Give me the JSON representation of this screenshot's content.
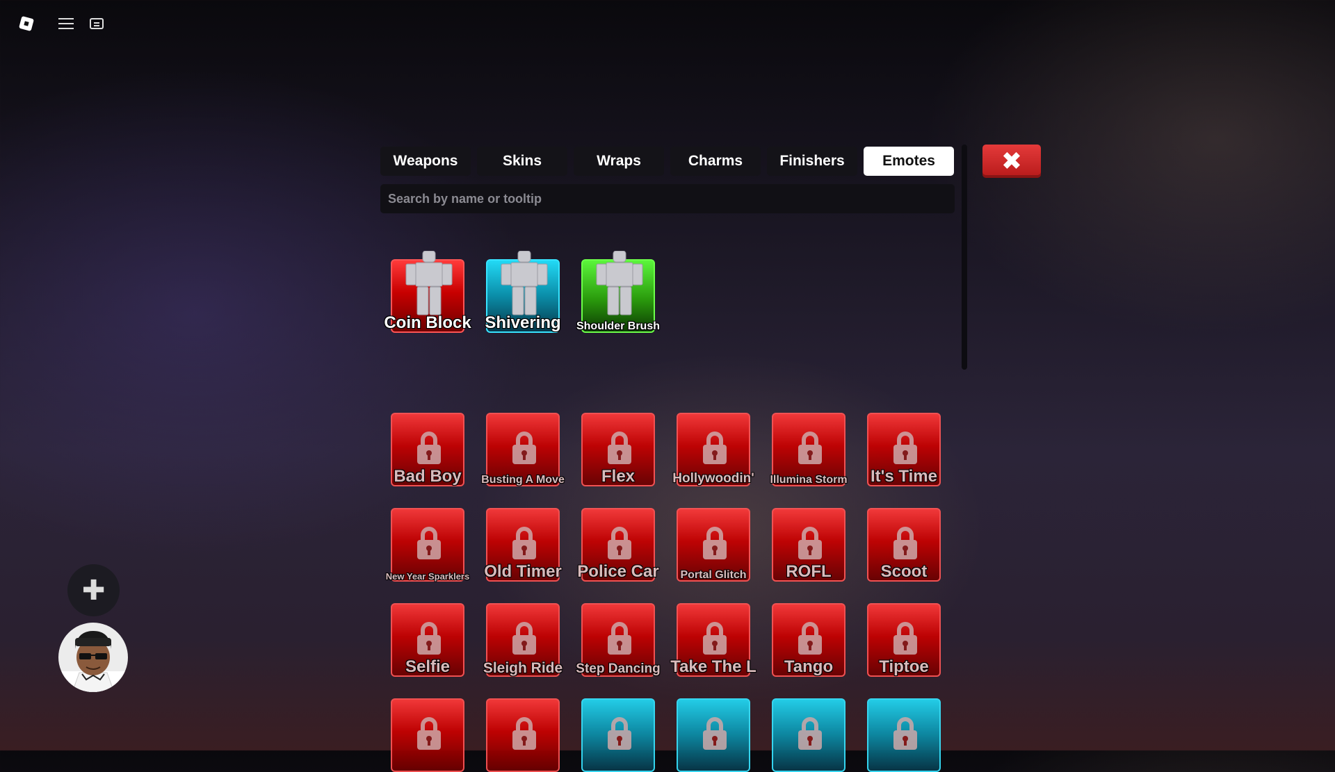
{
  "topbar": {
    "logo_icon": "roblox-logo-icon",
    "menu_icon": "hamburger-menu-icon",
    "chat_icon": "chat-icon"
  },
  "tabs": [
    {
      "label": "Weapons",
      "active": false
    },
    {
      "label": "Skins",
      "active": false
    },
    {
      "label": "Wraps",
      "active": false
    },
    {
      "label": "Charms",
      "active": false
    },
    {
      "label": "Finishers",
      "active": false
    },
    {
      "label": "Emotes",
      "active": true
    }
  ],
  "close_button": {
    "icon": "close-x-icon",
    "color": "#d62828"
  },
  "search": {
    "placeholder": "Search by name or tooltip",
    "value": ""
  },
  "equipped": [
    {
      "label": "Coin Block",
      "color": "red"
    },
    {
      "label": "Shivering",
      "color": "blue"
    },
    {
      "label": "Shoulder Brush",
      "color": "green"
    }
  ],
  "collection": [
    {
      "label": "Bad Boy",
      "color": "red",
      "locked": true
    },
    {
      "label": "Busting A Move",
      "color": "red",
      "locked": true
    },
    {
      "label": "Flex",
      "color": "red",
      "locked": true
    },
    {
      "label": "Hollywoodin'",
      "color": "red",
      "locked": true
    },
    {
      "label": "Illumina Storm",
      "color": "red",
      "locked": true
    },
    {
      "label": "It's Time",
      "color": "red",
      "locked": true
    },
    {
      "label": "New Year Sparklers",
      "color": "red",
      "locked": true
    },
    {
      "label": "Old Timer",
      "color": "red",
      "locked": true
    },
    {
      "label": "Police Car",
      "color": "red",
      "locked": true
    },
    {
      "label": "Portal Glitch",
      "color": "red",
      "locked": true
    },
    {
      "label": "ROFL",
      "color": "red",
      "locked": true
    },
    {
      "label": "Scoot",
      "color": "red",
      "locked": true
    },
    {
      "label": "Selfie",
      "color": "red",
      "locked": true
    },
    {
      "label": "Sleigh Ride",
      "color": "red",
      "locked": true
    },
    {
      "label": "Step Dancing",
      "color": "red",
      "locked": true
    },
    {
      "label": "Take The L",
      "color": "red",
      "locked": true
    },
    {
      "label": "Tango",
      "color": "red",
      "locked": true
    },
    {
      "label": "Tiptoe",
      "color": "red",
      "locked": true
    },
    {
      "label": "",
      "color": "red",
      "locked": true
    },
    {
      "label": "",
      "color": "red",
      "locked": true
    },
    {
      "label": "",
      "color": "blue",
      "locked": true
    },
    {
      "label": "",
      "color": "blue",
      "locked": true
    },
    {
      "label": "",
      "color": "blue",
      "locked": true
    },
    {
      "label": "",
      "color": "blue",
      "locked": true
    }
  ],
  "side": {
    "add_icon": "plus-icon",
    "avatar_icon": "player-avatar-icon"
  },
  "colors": {
    "red": "#d40000",
    "blue": "#0fb8d6",
    "green": "#3fc41a",
    "accent_close": "#d62828"
  }
}
